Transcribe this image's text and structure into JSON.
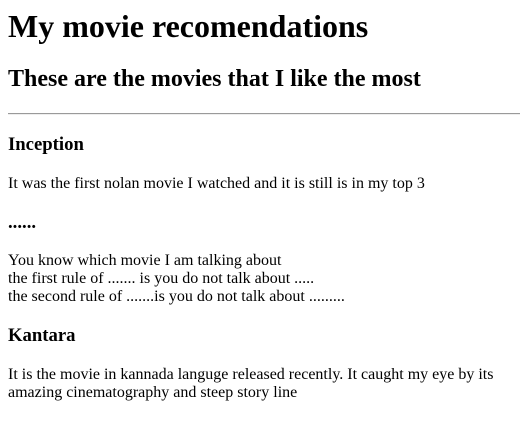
{
  "title": "My movie recomendations",
  "subtitle": "These are the movies that I like the most",
  "movies": [
    {
      "name": "Inception",
      "lines": [
        "It was the first nolan movie I watched and it is still is in my top 3"
      ]
    },
    {
      "name": "......",
      "lines": [
        "You know which movie I am talking about",
        "the first rule of ....... is you do not talk about .....",
        "the second rule of .......is you do not talk about ........."
      ]
    },
    {
      "name": "Kantara",
      "lines": [
        "It is the movie in kannada languge released recently. It caught my eye by its amazing cinematography and steep story line"
      ]
    }
  ]
}
